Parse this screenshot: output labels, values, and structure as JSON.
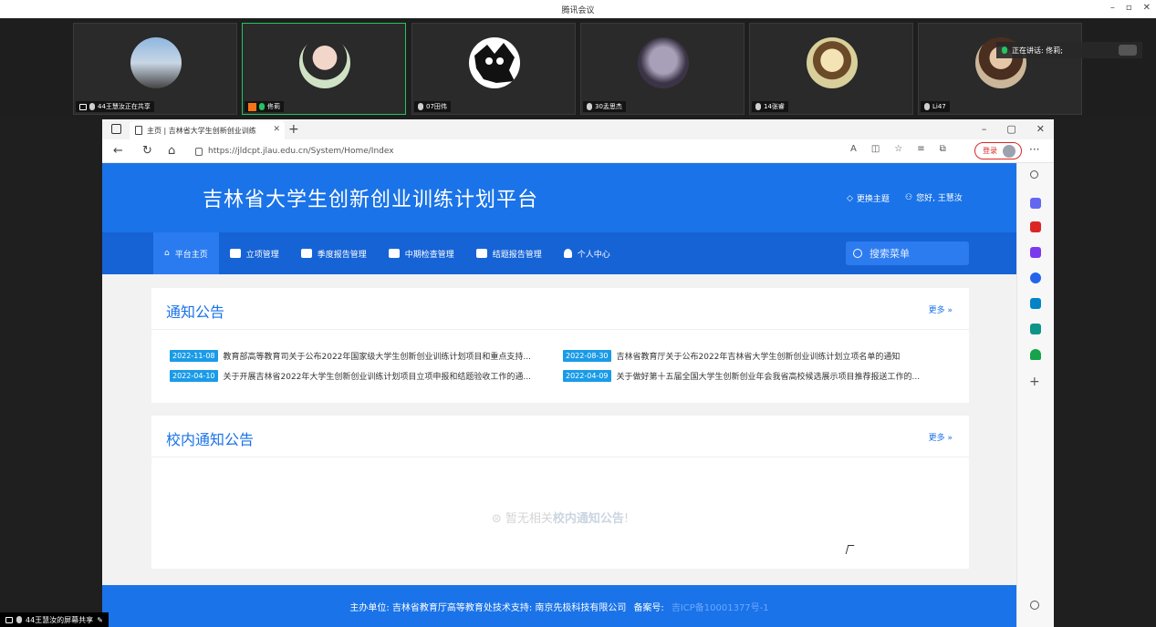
{
  "app": {
    "title": "腾讯会议",
    "win_controls": [
      "–",
      "▫",
      "✕"
    ]
  },
  "participants": [
    {
      "name": "44王慧汝正在共享",
      "sharing": true
    },
    {
      "name": "佟莉",
      "speaking": true
    },
    {
      "name": "07田伟"
    },
    {
      "name": "30孟思杰"
    },
    {
      "name": "14张睿"
    },
    {
      "name": "Li47"
    }
  ],
  "speaking_banner": {
    "label": "正在讲话: 佟莉;"
  },
  "browser": {
    "tab_title": "主页 | 吉林省大学生创新创业训练",
    "url": "https://jldcpt.jlau.edu.cn/System/Home/Index",
    "login_label": "登录",
    "win_controls": [
      "–",
      "▢",
      "✕"
    ]
  },
  "site": {
    "title": "吉林省大学生创新创业训练计划平台",
    "theme_label": "更换主题",
    "user_label": "您好, 王慧汝",
    "nav": [
      {
        "label": "平台主页",
        "active": true
      },
      {
        "label": "立项管理"
      },
      {
        "label": "季度报告管理"
      },
      {
        "label": "中期检查管理"
      },
      {
        "label": "结题报告管理"
      },
      {
        "label": "个人中心"
      }
    ],
    "search_placeholder": "搜索菜单"
  },
  "notices": {
    "title": "通知公告",
    "more": "更多 »",
    "items": [
      {
        "date": "2022-11-08",
        "text": "教育部高等教育司关于公布2022年国家级大学生创新创业训练计划项目和重点支持..."
      },
      {
        "date": "2022-08-30",
        "text": "吉林省教育厅关于公布2022年吉林省大学生创新创业训练计划立项名单的通知"
      },
      {
        "date": "2022-04-10",
        "text": "关于开展吉林省2022年大学生创新创业训练计划项目立项申报和结题验收工作的通..."
      },
      {
        "date": "2022-04-09",
        "text": "关于做好第十五届全国大学生创新创业年会我省高校候选展示项目推荐报送工作的..."
      }
    ]
  },
  "campus_notices": {
    "title": "校内通知公告",
    "more": "更多 »",
    "empty_prefix": "暂无相关",
    "empty_bold": "校内通知公告",
    "empty_suffix": "!"
  },
  "footer": {
    "text": "主办单位: 吉林省教育厅高等教育处技术支持: 南京先极科技有限公司",
    "icp_label": "备案号:",
    "icp_value": "吉ICP备10001377号-1"
  },
  "share_label": "44王慧汝的屏幕共享"
}
